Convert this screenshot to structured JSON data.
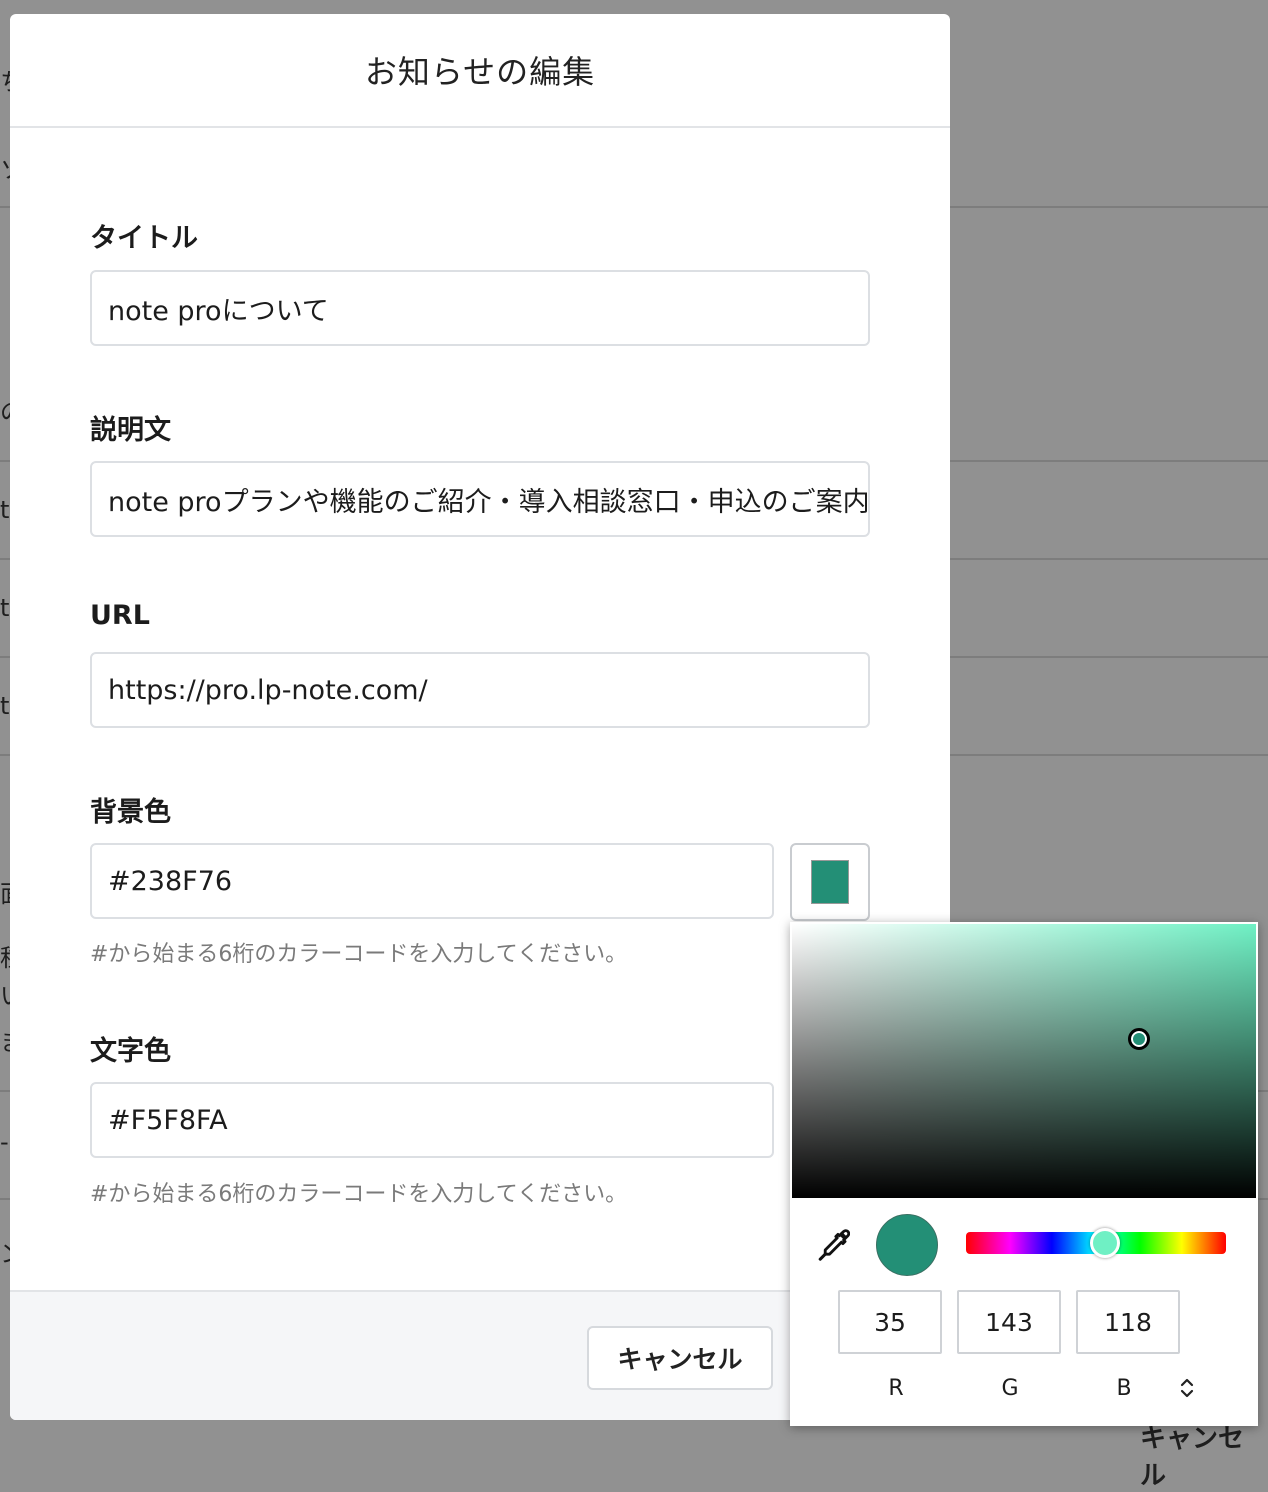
{
  "background": {
    "cancel_label": "キャンセル",
    "fragments": [
      "ち",
      "ソ",
      "の",
      "te",
      "te",
      "te",
      "面",
      "種",
      "い",
      "ま",
      "-",
      "ン"
    ]
  },
  "modal": {
    "title": "お知らせの編集",
    "fields": {
      "title": {
        "label": "タイトル",
        "value": "note proについて"
      },
      "description": {
        "label": "説明文",
        "value": "note proプランや機能のご紹介・導入相談窓口・申込のご案内"
      },
      "url": {
        "label": "URL",
        "value": "https://pro.lp-note.com/"
      },
      "bg_color": {
        "label": "背景色",
        "value": "#238F76",
        "help": "#から始まる6桁のカラーコードを入力してください。"
      },
      "text_color": {
        "label": "文字色",
        "value": "#F5F8FA",
        "help": "#から始まる6桁のカラーコードを入力してください。"
      }
    },
    "footer": {
      "cancel_label": "キャンセル"
    }
  },
  "color_picker": {
    "current_color": "#238F76",
    "r": "35",
    "g": "143",
    "b": "118",
    "labels": {
      "r": "R",
      "g": "G",
      "b": "B"
    },
    "icons": {
      "eyedropper": "eyedropper-icon",
      "toggle": "chevron-up-down-icon"
    }
  }
}
